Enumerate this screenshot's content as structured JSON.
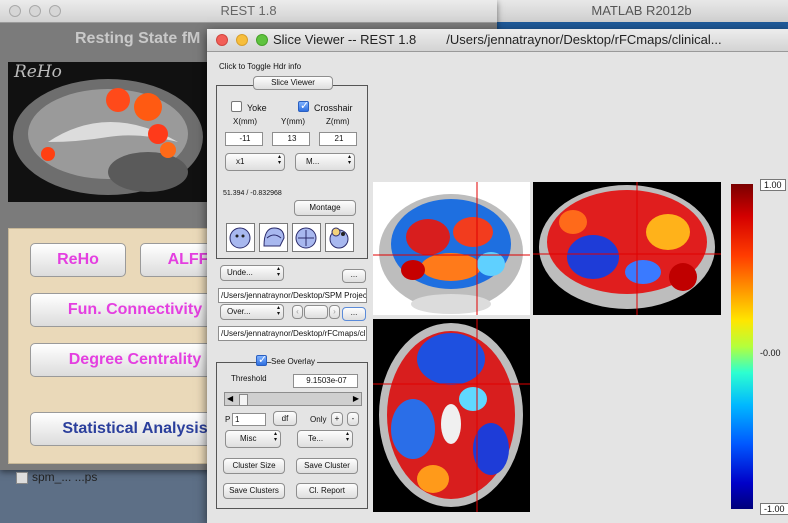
{
  "desktop": {
    "matlab_title": "MATLAB R2012b"
  },
  "rest_window": {
    "title": "REST 1.8",
    "header": "Resting State fM",
    "brain_label": "ReHo",
    "buttons": {
      "reho": "ReHo",
      "alff": "ALFF",
      "fc": "Fun. Connectivity",
      "dc": "Degree Centrality",
      "stats": "Statistical Analysis"
    },
    "file_row": "spm_... ...ps"
  },
  "slice_viewer": {
    "title": "Slice Viewer -- REST 1.8",
    "path": "/Users/jennatraynor/Desktop/rFCmaps/clinical...",
    "hdr_toggle": "Click to Toggle Hdr info",
    "group_label": "Slice Viewer",
    "yoke_label": "Yoke",
    "crosshair_label": "Crosshair",
    "coord_labels": {
      "x": "X(mm)",
      "y": "Y(mm)",
      "z": "Z(mm)"
    },
    "coords": {
      "x": "-11",
      "y": "13",
      "z": "21"
    },
    "zoom_select": "x1",
    "view_select": "M...",
    "value_readout": "51.394 / -0.832968",
    "montage_label": "Montage",
    "underlay_select": "Unde...",
    "browse_label": "...",
    "underlay_path": "/Users/jennatraynor/Desktop/SPM Projec",
    "overlay_select": "Over...",
    "overlay_path": "/Users/jennatraynor/Desktop/rFCmaps/cl",
    "see_overlay_label": "See Overlay",
    "threshold_label": "Threshold",
    "threshold_value": "9.1503e-07",
    "p_label": "P",
    "p_value": "1",
    "df_label": "df",
    "only_label": "Only",
    "plus_label": "+",
    "minus_label": "-",
    "misc_select": "Misc",
    "te_select": "Te...",
    "cluster_size": "Cluster Size",
    "save_cluster": "Save Cluster",
    "save_clusters": "Save Clusters",
    "cl_report": "Cl. Report",
    "colorbar": {
      "max": "1.00",
      "mid": "-0.00",
      "min": "-1.00"
    }
  },
  "colors": {
    "pink_text": "#e43fe0",
    "navy_text": "#2b3f9c",
    "panel_beige": "#ead9b9"
  },
  "yoke_checked": false,
  "crosshair_checked": true,
  "see_overlay_checked": true
}
